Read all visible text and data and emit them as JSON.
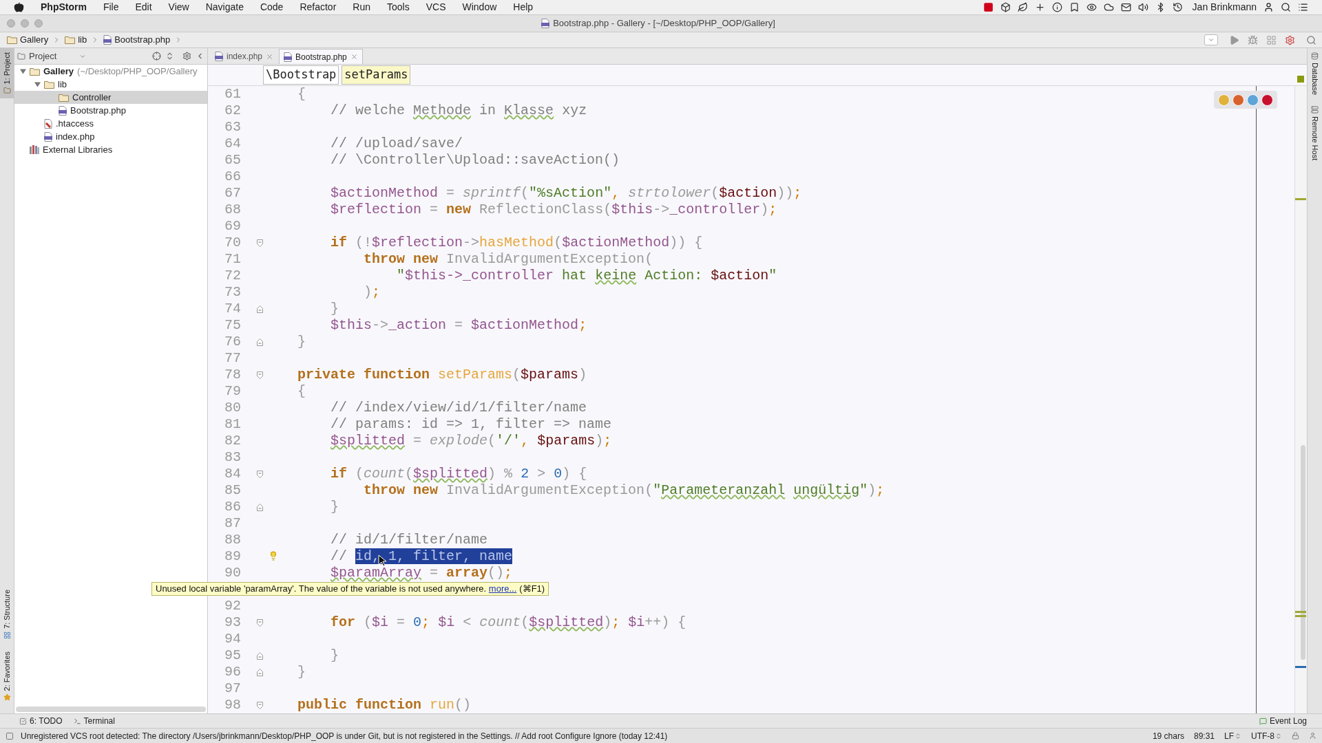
{
  "menubar": {
    "app": "PhpStorm",
    "menus": [
      "File",
      "Edit",
      "View",
      "Navigate",
      "Code",
      "Refactor",
      "Run",
      "Tools",
      "VCS",
      "Window",
      "Help"
    ],
    "user": "Jan Brinkmann"
  },
  "window": {
    "title": "Bootstrap.php - Gallery - [~/Desktop/PHP_OOP/Gallery]"
  },
  "navbar": {
    "crumbs": [
      {
        "label": "Gallery",
        "kind": "folder"
      },
      {
        "label": "lib",
        "kind": "folder"
      },
      {
        "label": "Bootstrap.php",
        "kind": "file"
      }
    ]
  },
  "left_strip": {
    "top": [
      {
        "label": "1: Project",
        "selected": true
      }
    ],
    "bottom": [
      {
        "label": "7: Structure",
        "selected": false
      },
      {
        "label": "2: Favorites",
        "selected": false
      }
    ]
  },
  "project_panel": {
    "title": "Project",
    "tree": [
      {
        "label": "Gallery",
        "path": "(~/Desktop/PHP_OOP/Gallery",
        "kind": "folder",
        "expanded": true,
        "selected": false,
        "children": [
          {
            "label": "lib",
            "kind": "folder",
            "expanded": true,
            "selected": false,
            "children": [
              {
                "label": "Controller",
                "kind": "folder",
                "selected": true
              },
              {
                "label": "Bootstrap.php",
                "kind": "php",
                "selected": false
              }
            ]
          },
          {
            "label": ".htaccess",
            "kind": "htaccess",
            "selected": false
          },
          {
            "label": "index.php",
            "kind": "php",
            "selected": false
          }
        ]
      },
      {
        "label": "External Libraries",
        "kind": "library",
        "selected": false
      }
    ]
  },
  "tabs": [
    {
      "label": "index.php",
      "selected": false
    },
    {
      "label": "Bootstrap.php",
      "selected": true
    }
  ],
  "editor": {
    "breadcrumbs": [
      {
        "label": "\\Bootstrap",
        "selected": false
      },
      {
        "label": "setParams",
        "selected": true
      }
    ],
    "lines": [
      {
        "number": "61",
        "kind": "code",
        "tokens": [
          {
            "kind": "operator",
            "text": "    {"
          }
        ]
      },
      {
        "number": "62",
        "kind": "code",
        "tokens": [
          {
            "kind": "comment",
            "text": "        // welche "
          },
          {
            "kind": "comment_typo",
            "text": "Methode"
          },
          {
            "kind": "comment",
            "text": " in "
          },
          {
            "kind": "comment_typo",
            "text": "Klasse"
          },
          {
            "kind": "comment",
            "text": " xyz"
          }
        ]
      },
      {
        "number": "63",
        "kind": "code"
      },
      {
        "number": "64",
        "kind": "code",
        "tokens": [
          {
            "kind": "comment",
            "text": "        // /upload/save/"
          }
        ]
      },
      {
        "number": "65",
        "kind": "code",
        "tokens": [
          {
            "kind": "comment",
            "text": "        // \\Controller\\Upload::saveAction()"
          }
        ]
      },
      {
        "number": "66",
        "kind": "code"
      },
      {
        "number": "67",
        "kind": "code",
        "tokens": [
          {
            "kind": "variable",
            "text": "        $actionMethod"
          },
          {
            "kind": "operator",
            "text": " = "
          },
          {
            "kind": "builtin",
            "text": "sprintf"
          },
          {
            "kind": "operator",
            "text": "("
          },
          {
            "kind": "string",
            "text": "\"%sAction\""
          },
          {
            "kind": "punctuation",
            "text": ", "
          },
          {
            "kind": "builtin",
            "text": "strtolower"
          },
          {
            "kind": "operator",
            "text": "("
          },
          {
            "kind": "parameter",
            "text": "$action"
          },
          {
            "kind": "operator",
            "text": "))"
          },
          {
            "kind": "punctuation",
            "text": ";"
          }
        ]
      },
      {
        "number": "68",
        "kind": "code",
        "tokens": [
          {
            "kind": "variable",
            "text": "        $reflection"
          },
          {
            "kind": "operator",
            "text": " = "
          },
          {
            "kind": "keyword",
            "text": "new "
          },
          {
            "kind": "class",
            "text": "ReflectionClass"
          },
          {
            "kind": "operator",
            "text": "("
          },
          {
            "kind": "variable",
            "text": "$this"
          },
          {
            "kind": "operator",
            "text": "->"
          },
          {
            "kind": "variable",
            "text": "_controller"
          },
          {
            "kind": "operator",
            "text": ")"
          },
          {
            "kind": "punctuation",
            "text": ";"
          }
        ]
      },
      {
        "number": "69",
        "kind": "code"
      },
      {
        "number": "70",
        "kind": "fold_start",
        "tokens": [
          {
            "kind": "keyword",
            "text": "        if"
          },
          {
            "kind": "operator",
            "text": " (!"
          },
          {
            "kind": "variable",
            "text": "$reflection"
          },
          {
            "kind": "operator",
            "text": "->"
          },
          {
            "kind": "method",
            "text": "hasMethod"
          },
          {
            "kind": "operator",
            "text": "("
          },
          {
            "kind": "variable",
            "text": "$actionMethod"
          },
          {
            "kind": "operator",
            "text": ")) {"
          }
        ]
      },
      {
        "number": "71",
        "kind": "code",
        "tokens": [
          {
            "kind": "keyword",
            "text": "            throw new "
          },
          {
            "kind": "class",
            "text": "InvalidArgumentException"
          },
          {
            "kind": "operator",
            "text": "("
          }
        ]
      },
      {
        "number": "72",
        "kind": "code",
        "tokens": [
          {
            "kind": "string",
            "text": "                \""
          },
          {
            "kind": "variable",
            "text": "$this->_controller"
          },
          {
            "kind": "string",
            "text": " hat "
          },
          {
            "kind": "string_typo",
            "text": "keine"
          },
          {
            "kind": "string",
            "text": " Action: "
          },
          {
            "kind": "parameter",
            "text": "$action"
          },
          {
            "kind": "string",
            "text": "\""
          }
        ]
      },
      {
        "number": "73",
        "kind": "code",
        "tokens": [
          {
            "kind": "operator",
            "text": "            )"
          },
          {
            "kind": "punctuation",
            "text": ";"
          }
        ]
      },
      {
        "number": "74",
        "kind": "fold_end",
        "tokens": [
          {
            "kind": "operator",
            "text": "        }"
          }
        ]
      },
      {
        "number": "75",
        "kind": "code",
        "tokens": [
          {
            "kind": "variable",
            "text": "        $this"
          },
          {
            "kind": "operator",
            "text": "->"
          },
          {
            "kind": "variable",
            "text": "_action"
          },
          {
            "kind": "operator",
            "text": " = "
          },
          {
            "kind": "variable",
            "text": "$actionMethod"
          },
          {
            "kind": "punctuation",
            "text": ";"
          }
        ]
      },
      {
        "number": "76",
        "kind": "fold_end",
        "tokens": [
          {
            "kind": "operator",
            "text": "    }"
          }
        ]
      },
      {
        "number": "77",
        "kind": "code"
      },
      {
        "number": "78",
        "kind": "fold_start",
        "tokens": [
          {
            "kind": "keyword",
            "text": "    private function "
          },
          {
            "kind": "method",
            "text": "setParams"
          },
          {
            "kind": "operator",
            "text": "("
          },
          {
            "kind": "parameter",
            "text": "$params"
          },
          {
            "kind": "operator",
            "text": ")"
          }
        ]
      },
      {
        "number": "79",
        "kind": "code",
        "tokens": [
          {
            "kind": "operator",
            "text": "    {"
          }
        ]
      },
      {
        "number": "80",
        "kind": "code",
        "tokens": [
          {
            "kind": "comment",
            "text": "        // /index/view/id/1/filter/name"
          }
        ]
      },
      {
        "number": "81",
        "kind": "code",
        "tokens": [
          {
            "kind": "comment",
            "text": "        // params: id => 1, filter => name"
          }
        ]
      },
      {
        "number": "82",
        "kind": "code",
        "tokens": [
          {
            "kind": "variable_typo",
            "text": "        $splitted"
          },
          {
            "kind": "operator",
            "text": " = "
          },
          {
            "kind": "builtin",
            "text": "explode"
          },
          {
            "kind": "operator",
            "text": "("
          },
          {
            "kind": "string",
            "text": "'/'"
          },
          {
            "kind": "punctuation",
            "text": ", "
          },
          {
            "kind": "parameter",
            "text": "$params"
          },
          {
            "kind": "operator",
            "text": ")"
          },
          {
            "kind": "punctuation",
            "text": ";"
          }
        ]
      },
      {
        "number": "83",
        "kind": "code"
      },
      {
        "number": "84",
        "kind": "fold_start",
        "tokens": [
          {
            "kind": "keyword",
            "text": "        if"
          },
          {
            "kind": "operator",
            "text": " ("
          },
          {
            "kind": "builtin",
            "text": "count"
          },
          {
            "kind": "operator",
            "text": "("
          },
          {
            "kind": "variable_typo",
            "text": "$splitted"
          },
          {
            "kind": "operator",
            "text": ") % "
          },
          {
            "kind": "number",
            "text": "2"
          },
          {
            "kind": "operator",
            "text": " > "
          },
          {
            "kind": "number",
            "text": "0"
          },
          {
            "kind": "operator",
            "text": ") {"
          }
        ]
      },
      {
        "number": "85",
        "kind": "code",
        "tokens": [
          {
            "kind": "keyword",
            "text": "            throw new "
          },
          {
            "kind": "class",
            "text": "InvalidArgumentException"
          },
          {
            "kind": "operator",
            "text": "("
          },
          {
            "kind": "string",
            "text": "\""
          },
          {
            "kind": "string_typo",
            "text": "Parameteranzahl "
          },
          {
            "kind": "string_typo",
            "text": "ungültig"
          },
          {
            "kind": "string",
            "text": "\""
          },
          {
            "kind": "operator",
            "text": ")"
          },
          {
            "kind": "punctuation",
            "text": ";"
          }
        ]
      },
      {
        "number": "86",
        "kind": "fold_end",
        "tokens": [
          {
            "kind": "operator",
            "text": "        }"
          }
        ]
      },
      {
        "number": "87",
        "kind": "code"
      },
      {
        "number": "88",
        "kind": "code",
        "tokens": [
          {
            "kind": "comment",
            "text": "        // id/1/filter/name"
          }
        ]
      },
      {
        "number": "89",
        "kind": "code",
        "bulb": true,
        "tokens": [
          {
            "kind": "comment",
            "text": "        // "
          },
          {
            "kind": "selection",
            "text": "id, 1, filter, name"
          }
        ]
      },
      {
        "number": "90",
        "kind": "code",
        "tokens": [
          {
            "kind": "variable_typo",
            "text": "        $paramArray"
          },
          {
            "kind": "operator",
            "text": " = "
          },
          {
            "kind": "keyword",
            "text": "array"
          },
          {
            "kind": "operator",
            "text": "()"
          },
          {
            "kind": "punctuation",
            "text": ";"
          }
        ]
      },
      {
        "kind": "covered"
      },
      {
        "number": "92",
        "kind": "code"
      },
      {
        "number": "93",
        "kind": "fold_start",
        "tokens": [
          {
            "kind": "keyword",
            "text": "        for"
          },
          {
            "kind": "operator",
            "text": " ("
          },
          {
            "kind": "variable",
            "text": "$i"
          },
          {
            "kind": "operator",
            "text": " = "
          },
          {
            "kind": "number",
            "text": "0"
          },
          {
            "kind": "punctuation",
            "text": "; "
          },
          {
            "kind": "variable",
            "text": "$i"
          },
          {
            "kind": "operator",
            "text": " < "
          },
          {
            "kind": "builtin",
            "text": "count"
          },
          {
            "kind": "operator",
            "text": "("
          },
          {
            "kind": "variable_typo",
            "text": "$splitted"
          },
          {
            "kind": "operator",
            "text": ")"
          },
          {
            "kind": "punctuation",
            "text": "; "
          },
          {
            "kind": "variable",
            "text": "$i"
          },
          {
            "kind": "operator",
            "text": "++) {"
          }
        ]
      },
      {
        "number": "94",
        "kind": "code"
      },
      {
        "number": "95",
        "kind": "fold_end",
        "tokens": [
          {
            "kind": "operator",
            "text": "        }"
          }
        ]
      },
      {
        "number": "96",
        "kind": "fold_end",
        "tokens": [
          {
            "kind": "operator",
            "text": "    }"
          }
        ]
      },
      {
        "number": "97",
        "kind": "code"
      },
      {
        "number": "98",
        "kind": "fold_start",
        "tokens": [
          {
            "kind": "keyword",
            "text": "    public function "
          },
          {
            "kind": "method",
            "text": "run"
          },
          {
            "kind": "operator",
            "text": "()"
          }
        ]
      }
    ],
    "tooltip": {
      "message": "Unused local variable 'paramArray'. The value of the variable is not used anywhere. ",
      "link": "more...",
      "shortcut": "(⌘F1)"
    }
  },
  "right_strip": [
    {
      "label": "Database"
    },
    {
      "label": "Remote Host"
    }
  ],
  "bottom_tools": {
    "left": [
      "6: TODO",
      "Terminal"
    ],
    "right": [
      "Event Log"
    ]
  },
  "status_bar": {
    "message": "Unregistered VCS root detected: The directory /Users/jbrinkmann/Desktop/PHP_OOP is under Git, but is not registered in the Settings. // Add root  Configure  Ignore (today 12:41)",
    "items": [
      {
        "label": "19 chars",
        "dropdown": false
      },
      {
        "label": "89:31",
        "dropdown": false
      },
      {
        "label": "LF",
        "dropdown": true
      },
      {
        "label": "UTF-8",
        "dropdown": true
      }
    ]
  }
}
